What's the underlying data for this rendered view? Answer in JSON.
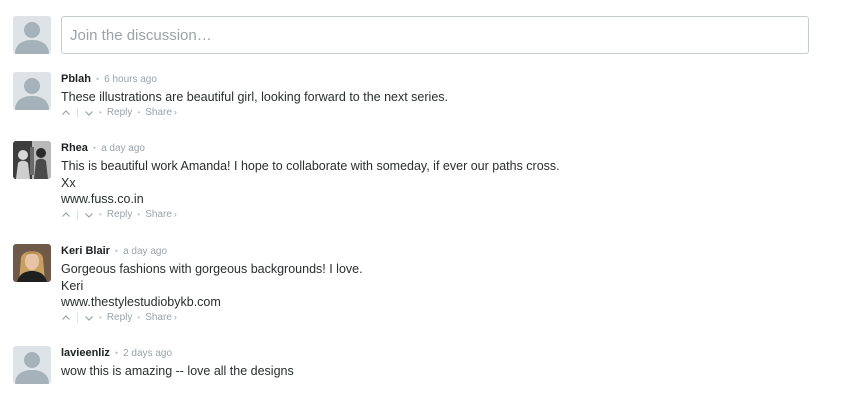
{
  "compose": {
    "placeholder": "Join the discussion…"
  },
  "actions": {
    "reply_label": "Reply",
    "share_label": "Share",
    "share_chevron": "›"
  },
  "comments": [
    {
      "author": "Pblah",
      "time": "6 hours ago",
      "lines": [
        "These illustrations are beautiful girl, looking forward to the next series."
      ],
      "avatar": "default-avatar",
      "has_actions": true
    },
    {
      "author": "Rhea",
      "time": "a day ago",
      "lines": [
        "This is beautiful work Amanda! I hope to collaborate with someday, if ever our paths cross.",
        "Xx",
        "www.fuss.co.in"
      ],
      "avatar": "photo-avatar-bw",
      "has_actions": true
    },
    {
      "author": "Keri Blair",
      "time": "a day ago",
      "lines": [
        "Gorgeous fashions with gorgeous backgrounds! I love.",
        "Keri",
        "www.thestylestudiobykb.com"
      ],
      "avatar": "photo-avatar-blonde",
      "has_actions": true
    },
    {
      "author": "lavieenliz",
      "time": "2 days ago",
      "lines": [
        "wow this is amazing -- love all the designs"
      ],
      "avatar": "default-avatar",
      "has_actions": false
    }
  ],
  "colors": {
    "avatar_bg": "#dde3e7",
    "avatar_fg": "#a5b2b9",
    "meta_gray": "#9aa3a8",
    "text": "#2a2e2e"
  }
}
